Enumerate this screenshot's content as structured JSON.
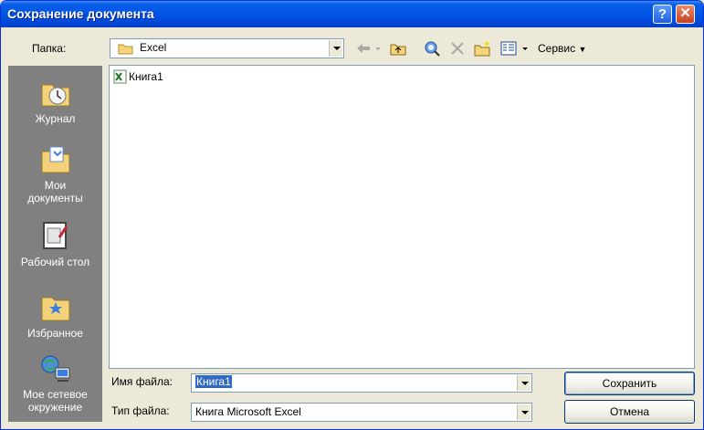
{
  "window": {
    "title": "Сохранение документа",
    "help_label": "?",
    "close_label": "✕"
  },
  "toolbar": {
    "folder_label": "Папка:",
    "folder_value": "Excel",
    "service_label": "Сервис"
  },
  "places": [
    {
      "label_lines": [
        "Журнал"
      ],
      "icon": "history-icon"
    },
    {
      "label_lines": [
        "Мои",
        "документы"
      ],
      "icon": "my-documents-icon"
    },
    {
      "label_lines": [
        "Рабочий стол"
      ],
      "icon": "desktop-icon"
    },
    {
      "label_lines": [
        "Избранное"
      ],
      "icon": "favorites-icon"
    },
    {
      "label_lines": [
        "Мое сетевое",
        "окружение"
      ],
      "icon": "network-places-icon"
    }
  ],
  "files": [
    {
      "name": "Книга1",
      "icon": "excel-workbook-icon"
    }
  ],
  "form": {
    "filename_label": "Имя файла:",
    "filename_value": "Книга1",
    "filetype_label": "Тип файла:",
    "filetype_value": "Книга Microsoft Excel"
  },
  "buttons": {
    "save_label": "Сохранить",
    "cancel_label": "Отмена"
  },
  "colors": {
    "title_bar": "#0055e5",
    "places_bar": "#808080",
    "dialog_bg": "#ece9d8"
  }
}
